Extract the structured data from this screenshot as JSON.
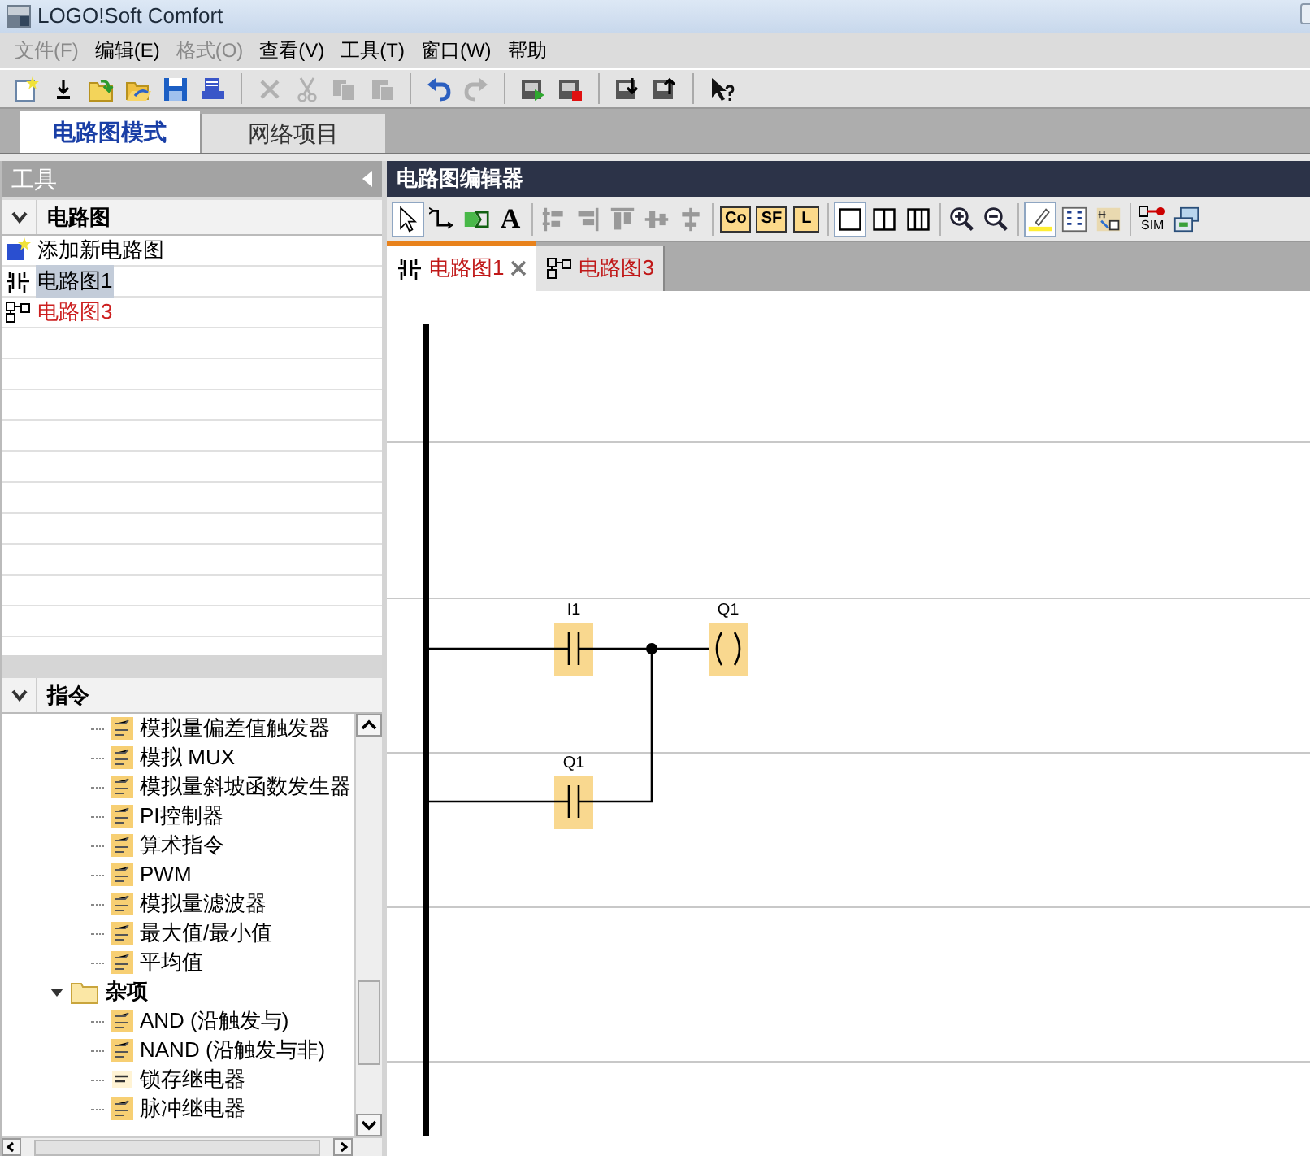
{
  "window": {
    "title": "LOGO!Soft Comfort"
  },
  "menu": [
    {
      "label": "文件(F)",
      "disabled": true
    },
    {
      "label": "编辑(E)",
      "disabled": false
    },
    {
      "label": "格式(O)",
      "disabled": true
    },
    {
      "label": "查看(V)",
      "disabled": false
    },
    {
      "label": "工具(T)",
      "disabled": false
    },
    {
      "label": "窗口(W)",
      "disabled": false
    },
    {
      "label": "帮助",
      "disabled": false
    }
  ],
  "toolbar": [
    {
      "kind": "new",
      "disabled": false
    },
    {
      "kind": "import",
      "disabled": false
    },
    {
      "kind": "open_new",
      "disabled": false
    },
    {
      "kind": "open",
      "disabled": false
    },
    {
      "kind": "save",
      "disabled": false
    },
    {
      "kind": "print",
      "disabled": false
    },
    {
      "kind": "sep"
    },
    {
      "kind": "delete",
      "disabled": true
    },
    {
      "kind": "cut",
      "disabled": true
    },
    {
      "kind": "copy",
      "disabled": true
    },
    {
      "kind": "paste",
      "disabled": true
    },
    {
      "kind": "sep"
    },
    {
      "kind": "undo",
      "disabled": false
    },
    {
      "kind": "redo",
      "disabled": true
    },
    {
      "kind": "sep"
    },
    {
      "kind": "start",
      "disabled": false
    },
    {
      "kind": "stop",
      "disabled": false
    },
    {
      "kind": "sep"
    },
    {
      "kind": "download",
      "disabled": false
    },
    {
      "kind": "upload",
      "disabled": false
    },
    {
      "kind": "sep"
    },
    {
      "kind": "help",
      "disabled": false
    }
  ],
  "mode_tabs": [
    {
      "label": "电路图模式",
      "selected": true
    },
    {
      "label": "网络项目",
      "selected": false
    }
  ],
  "tools_panel": {
    "title": "工具",
    "circuits": {
      "title": "电路图",
      "expanded": true,
      "items": [
        {
          "label": "添加新电路图",
          "kind": "add",
          "selected": false,
          "color": "#000000"
        },
        {
          "label": "电路图1",
          "kind": "ladder",
          "selected": true,
          "color": "#000000"
        },
        {
          "label": "电路图3",
          "kind": "fbd",
          "selected": false,
          "color": "#cc1f1f"
        }
      ]
    },
    "instructions": {
      "title": "指令",
      "expanded": true,
      "tree": [
        {
          "kind": "group",
          "children": [
            {
              "label": "模拟量偏差值触发器",
              "kind": "block"
            },
            {
              "label": "模拟 MUX",
              "kind": "block"
            },
            {
              "label": "模拟量斜坡函数发生器",
              "kind": "block"
            },
            {
              "label": "PI控制器",
              "kind": "block"
            },
            {
              "label": "算术指令",
              "kind": "block"
            },
            {
              "label": "PWM",
              "kind": "block"
            },
            {
              "label": "模拟量滤波器",
              "kind": "block"
            },
            {
              "label": "最大值/最小值",
              "kind": "block"
            },
            {
              "label": "平均值",
              "kind": "block"
            }
          ]
        },
        {
          "label": "杂项",
          "kind": "folder",
          "expanded": true,
          "children": [
            {
              "label": "AND (沿触发与)",
              "kind": "block"
            },
            {
              "label": "NAND (沿触发与非)",
              "kind": "block"
            },
            {
              "label": "锁存继电器",
              "kind": "plain"
            },
            {
              "label": "脉冲继电器",
              "kind": "block"
            }
          ]
        }
      ]
    }
  },
  "editor": {
    "title": "电路图编辑器",
    "toolbar": [
      {
        "kind": "select",
        "selected": true
      },
      {
        "kind": "connect",
        "selected": false
      },
      {
        "kind": "block",
        "selected": false
      },
      {
        "kind": "text",
        "label": "A",
        "selected": false
      },
      {
        "kind": "sep"
      },
      {
        "kind": "align_left",
        "selected": false
      },
      {
        "kind": "align_right",
        "selected": false
      },
      {
        "kind": "align_top",
        "selected": false
      },
      {
        "kind": "align_middle",
        "selected": false
      },
      {
        "kind": "align_center",
        "selected": false
      },
      {
        "kind": "sep"
      },
      {
        "kind": "tag",
        "label": "Co",
        "selected": false
      },
      {
        "kind": "tag",
        "label": "SF",
        "selected": false
      },
      {
        "kind": "tag",
        "label": "L",
        "selected": false
      },
      {
        "kind": "sep"
      },
      {
        "kind": "layout1",
        "selected": true
      },
      {
        "kind": "layout2",
        "selected": false
      },
      {
        "kind": "layout3",
        "selected": false
      },
      {
        "kind": "sep"
      },
      {
        "kind": "zoom_in",
        "selected": false
      },
      {
        "kind": "zoom_out",
        "selected": false
      },
      {
        "kind": "sep"
      },
      {
        "kind": "highlight",
        "selected": true
      },
      {
        "kind": "numbering",
        "selected": false
      },
      {
        "kind": "mapping",
        "selected": false
      },
      {
        "kind": "sep"
      },
      {
        "kind": "sim",
        "label": "SIM",
        "selected": false
      },
      {
        "kind": "online",
        "selected": false
      }
    ],
    "tabs": [
      {
        "label": "电路图1",
        "kind": "ladder",
        "selected": true,
        "closable": true
      },
      {
        "label": "电路图3",
        "kind": "fbd",
        "selected": false,
        "closable": false
      }
    ],
    "diagram": {
      "rungs": [
        {
          "elements": [
            {
              "kind": "contact",
              "label": "I1"
            },
            {
              "kind": "coil",
              "label": "Q1"
            }
          ]
        },
        {
          "elements": [
            {
              "kind": "contact",
              "label": "Q1"
            }
          ]
        }
      ]
    }
  }
}
